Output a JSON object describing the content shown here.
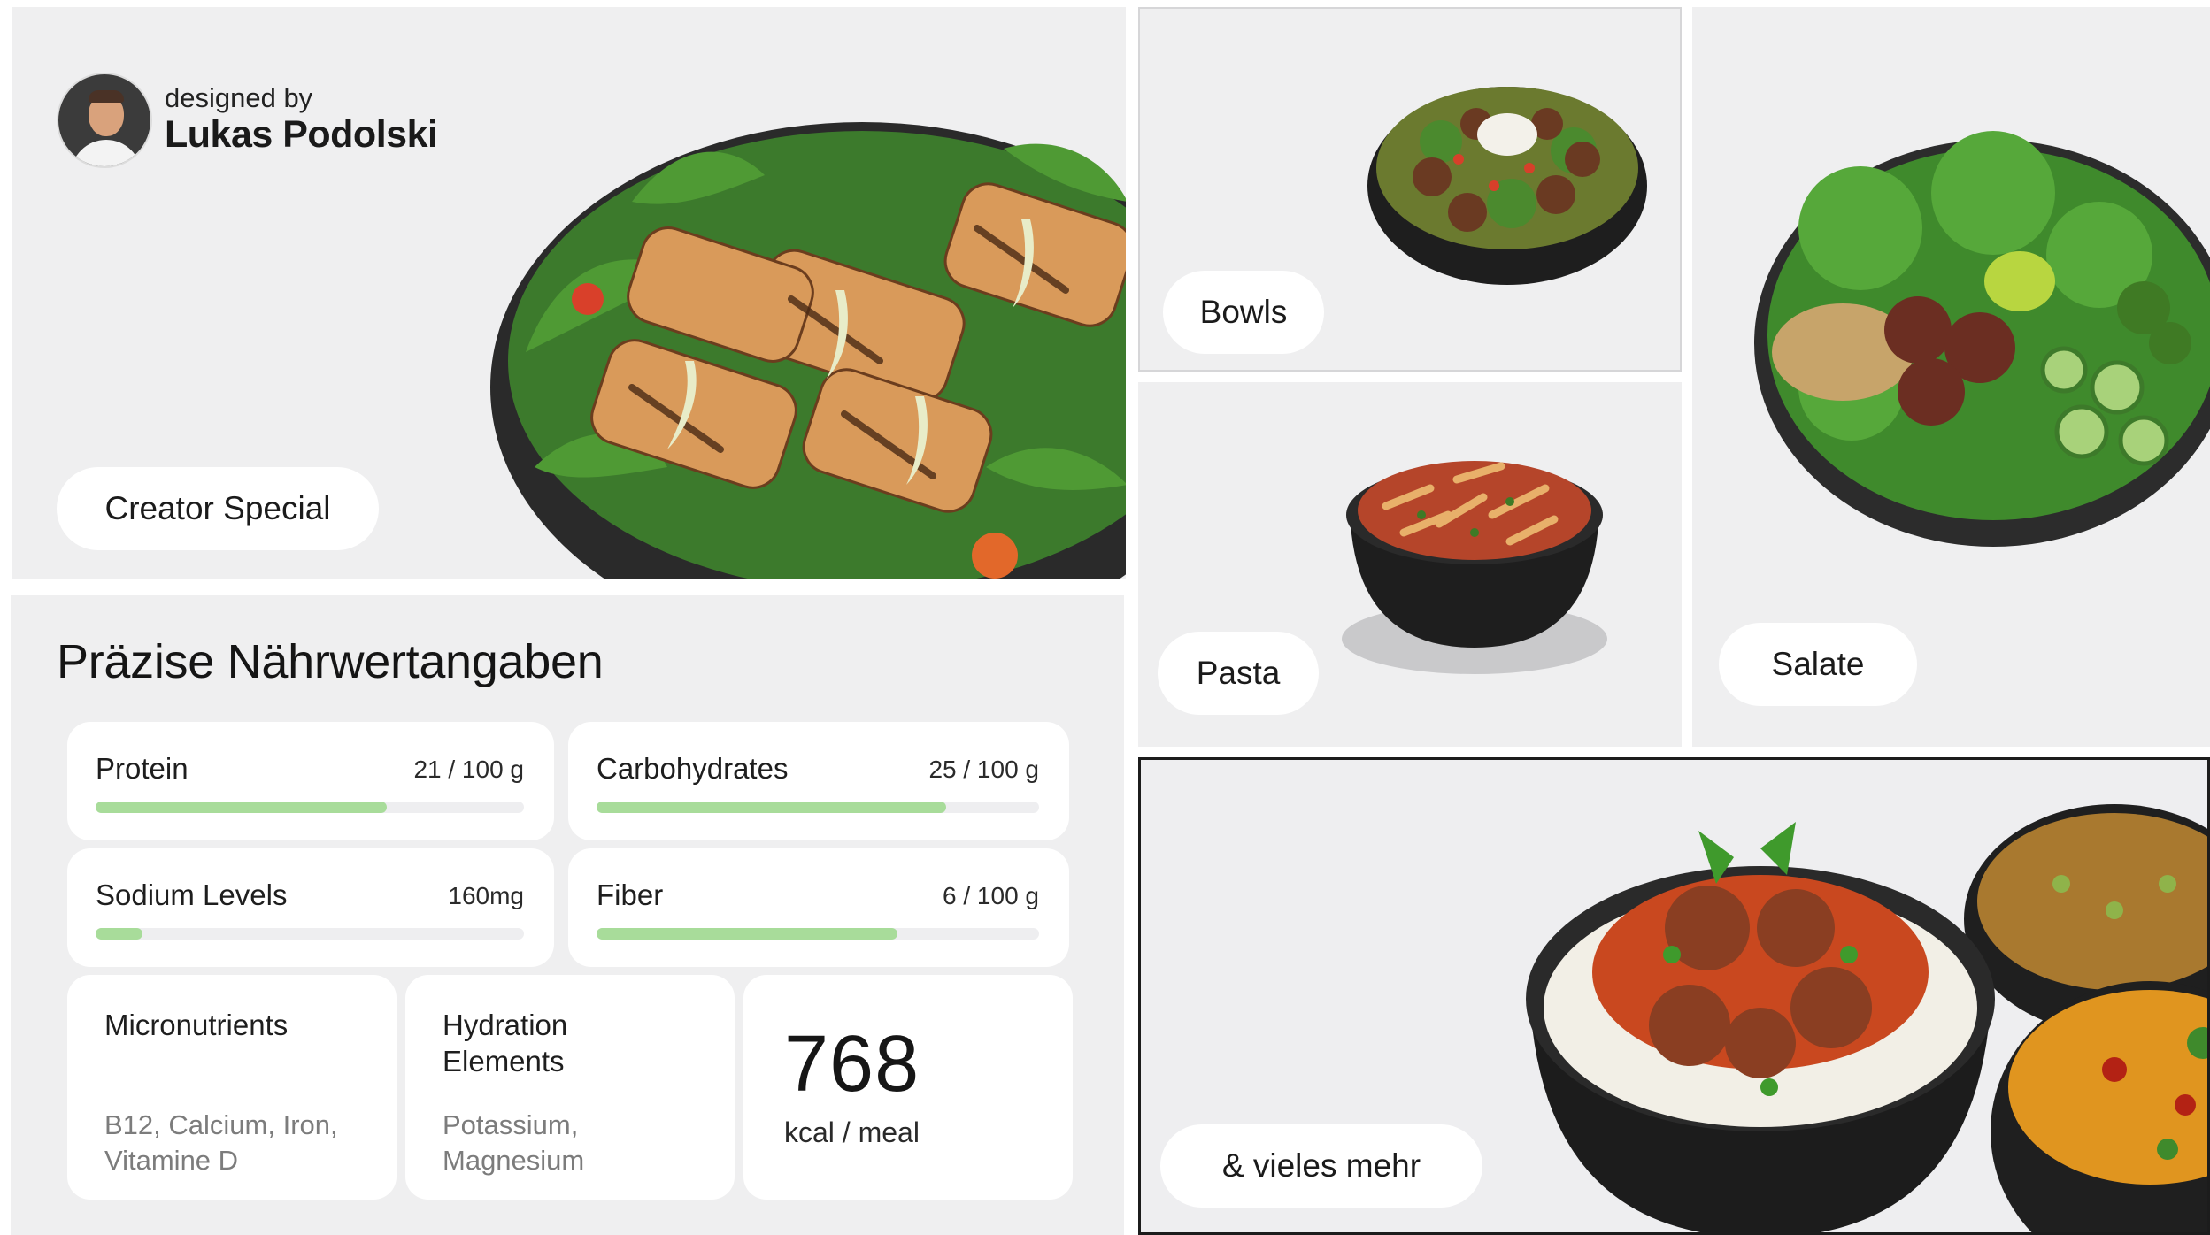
{
  "creator": {
    "designed_by": "designed by",
    "name": "Lukas Podolski",
    "badge": "Creator Special"
  },
  "nutrition": {
    "title": "Präzise Nährwertangaben",
    "macros": [
      {
        "label": "Protein",
        "value": "21 / 100 g",
        "fill": 0.68
      },
      {
        "label": "Carbohydrates",
        "value": "25 / 100 g",
        "fill": 0.79
      },
      {
        "label": "Sodium Levels",
        "value": "160mg",
        "fill": 0.11
      },
      {
        "label": "Fiber",
        "value": "6 / 100 g",
        "fill": 0.68
      }
    ],
    "micronutrients": {
      "title": "Micronutrients",
      "body": "B12, Calcium, Iron, Vitamine D"
    },
    "hydration": {
      "title": "Hydration Elements",
      "body": "Potassium, Magnesium"
    },
    "energy": {
      "value": "768",
      "unit": "kcal / meal"
    }
  },
  "categories": {
    "bowls": "Bowls",
    "pasta": "Pasta",
    "salate": "Salate",
    "more": "& vieles mehr"
  },
  "colors": {
    "panel_bg": "#efeff0",
    "bar_fill": "#a8dc9a",
    "bar_track": "#eeeef0"
  }
}
